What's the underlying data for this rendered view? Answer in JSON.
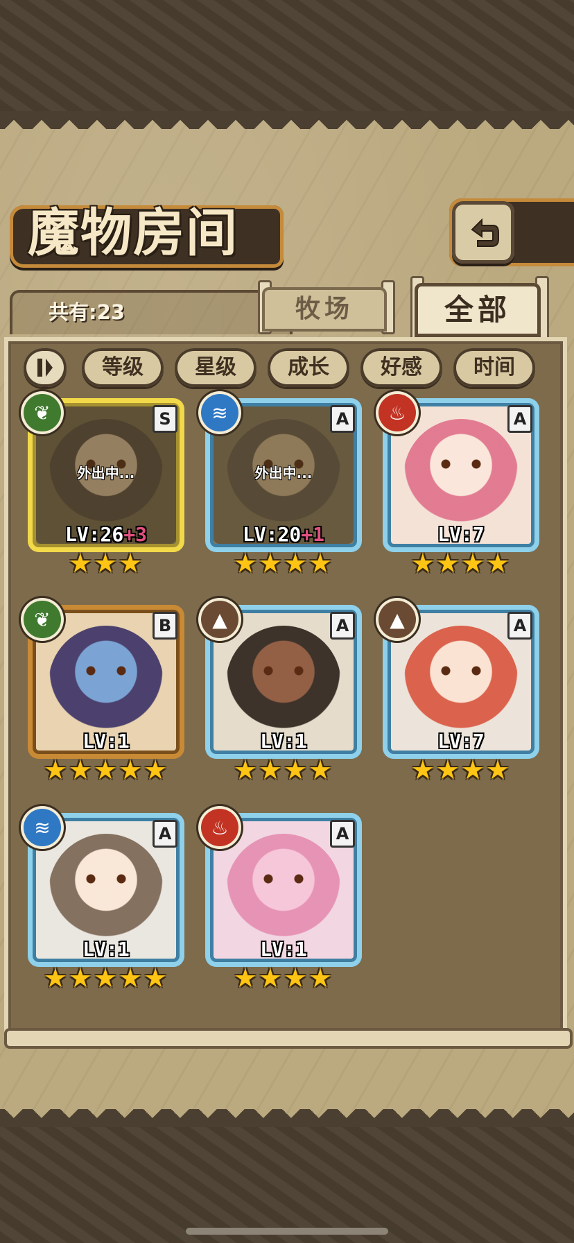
{
  "screen": {
    "title": "魔物房间",
    "count_label": "共有:23",
    "tabs": [
      {
        "label": "牧场",
        "selected": false
      },
      {
        "label": "全部",
        "selected": true
      }
    ]
  },
  "sort": {
    "toggle_icon": "pause-sort-icon",
    "options": [
      "等级",
      "星级",
      "成长",
      "好感",
      "时间"
    ]
  },
  "monsters": [
    {
      "element": "leaf",
      "rank": "S",
      "level": "LV:26",
      "bonus": "+3",
      "status": "外出中...",
      "stars": "★★★",
      "frame": "gold-yellow"
    },
    {
      "element": "water",
      "rank": "A",
      "level": "LV:20",
      "bonus": "+1",
      "status": "外出中...",
      "stars": "★★★★",
      "frame": "blue"
    },
    {
      "element": "fire",
      "rank": "A",
      "level": "LV:7",
      "bonus": "",
      "status": "",
      "stars": "★★★★",
      "frame": "blue"
    },
    {
      "element": "leaf",
      "rank": "B",
      "level": "LV:1",
      "bonus": "",
      "status": "",
      "stars": "★★★★★",
      "frame": "bronze"
    },
    {
      "element": "earth",
      "rank": "A",
      "level": "LV:1",
      "bonus": "",
      "status": "",
      "stars": "★★★★",
      "frame": "blue"
    },
    {
      "element": "earth",
      "rank": "A",
      "level": "LV:7",
      "bonus": "",
      "status": "",
      "stars": "★★★★",
      "frame": "blue"
    },
    {
      "element": "water",
      "rank": "A",
      "level": "LV:1",
      "bonus": "",
      "status": "",
      "stars": "★★★★★",
      "frame": "blue"
    },
    {
      "element": "fire",
      "rank": "A",
      "level": "LV:1",
      "bonus": "",
      "status": "",
      "stars": "★★★★",
      "frame": "blue"
    }
  ],
  "colors": {
    "leaf": "#3f7a2e",
    "water": "#2f78c4",
    "fire": "#c23323",
    "earth": "#6b4a33",
    "gold_frame": "#f2d94a",
    "blue_frame": "#8fd0ea",
    "bronze_frame": "#c98a36"
  }
}
